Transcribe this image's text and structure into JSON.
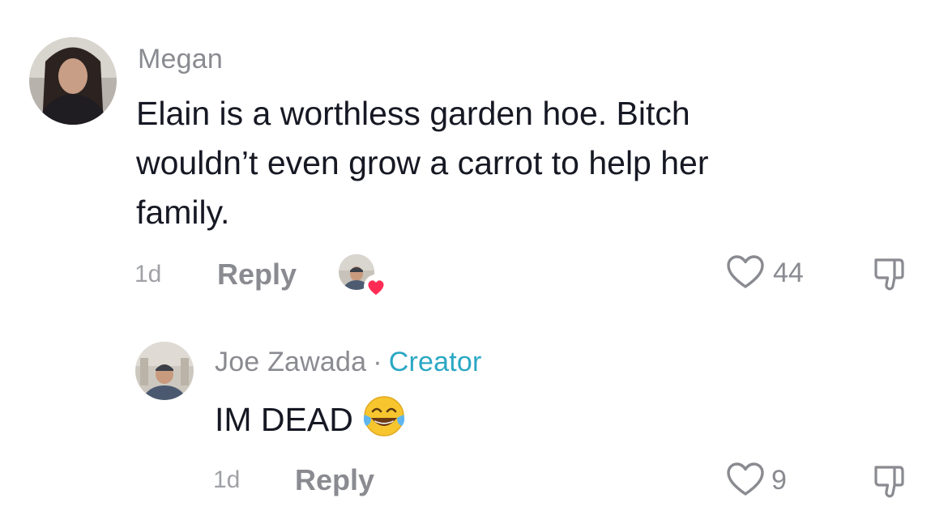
{
  "comments": [
    {
      "username": "Megan",
      "text_lines": [
        "Elain is a worthless garden hoe. Bitch",
        "wouldn’t even grow a carrot to help her",
        "family."
      ],
      "time": "1d",
      "reply_label": "Reply",
      "likes": "44",
      "creator_liked": true
    },
    {
      "username": "Joe Zawada",
      "separator": "·",
      "badge": "Creator",
      "text": "IM DEAD",
      "emoji": "face-with-tears-of-joy",
      "time": "1d",
      "reply_label": "Reply",
      "likes": "9"
    }
  ],
  "colors": {
    "text": "#161823",
    "meta": "#8a8b91",
    "creator": "#2aa8c4",
    "heart_badge": "#fe2c55"
  },
  "icons": [
    "heart-outline-icon",
    "thumbs-down-icon",
    "red-heart-badge-icon"
  ]
}
